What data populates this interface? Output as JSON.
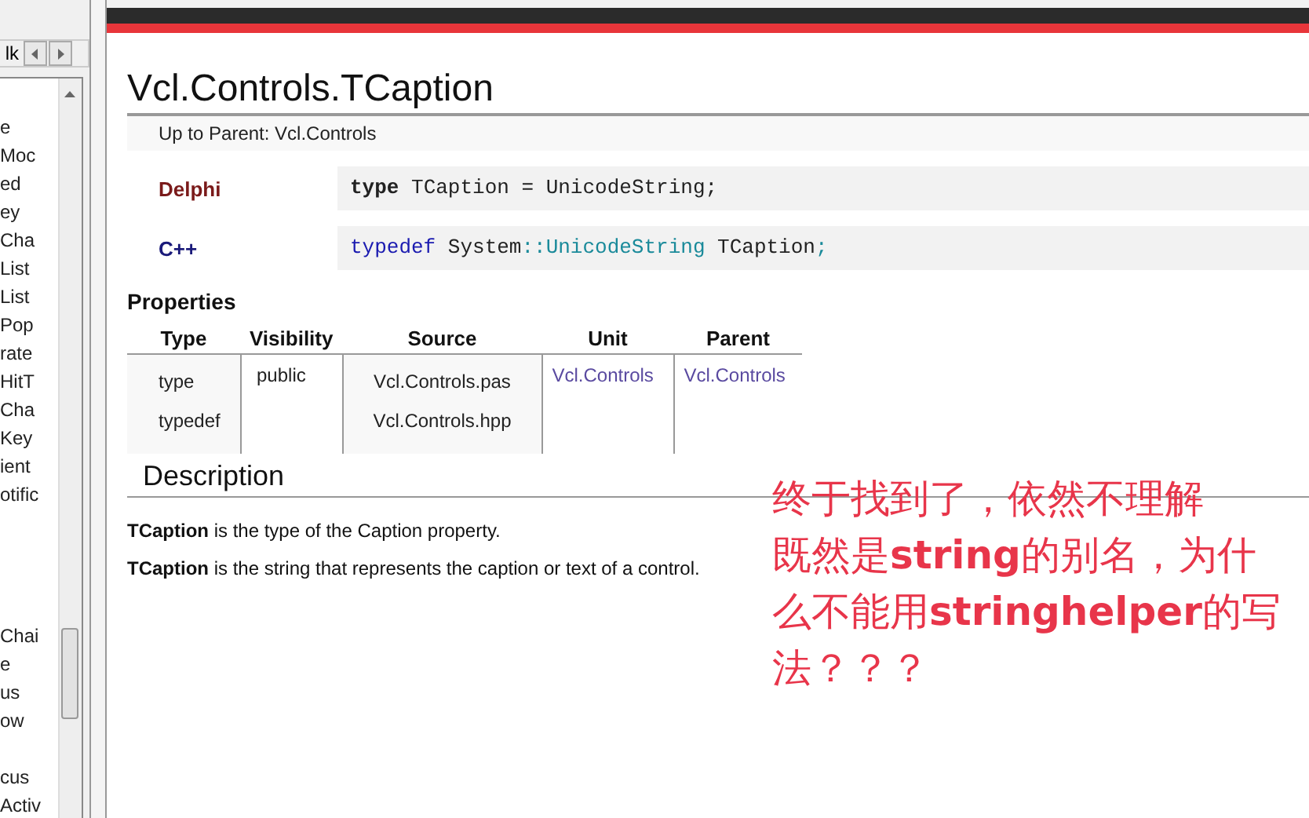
{
  "sidebar": {
    "toolbar_text": "lk",
    "item_groups": [
      [
        "e",
        "Moc",
        "ed",
        "ey",
        "Cha",
        "List",
        "List",
        "Pop",
        "rate",
        "HitT",
        "Cha",
        "Key",
        "ient",
        "otific"
      ],
      [
        "Chai",
        "e",
        "us",
        "ow"
      ],
      [
        "cus",
        "Activ"
      ]
    ]
  },
  "page": {
    "title": "Vcl.Controls.TCaption",
    "parent_link": "Up to Parent: Vcl.Controls",
    "syntax": [
      {
        "language": "Delphi",
        "kind": "delphi",
        "tokens": [
          {
            "text": "type",
            "kind": "keyword"
          },
          {
            "text": " TCaption = UnicodeString;",
            "kind": "plain"
          }
        ]
      },
      {
        "language": "C++",
        "kind": "cpp",
        "tokens": [
          {
            "text": "typedef",
            "kind": "keyword"
          },
          {
            "text": " System",
            "kind": "plain"
          },
          {
            "text": "::",
            "kind": "op"
          },
          {
            "text": "UnicodeString",
            "kind": "type"
          },
          {
            "text": " TCaption",
            "kind": "plain"
          },
          {
            "text": ";",
            "kind": "op"
          }
        ]
      }
    ],
    "properties_heading": "Properties",
    "table": {
      "columns": [
        "Type",
        "Visibility",
        "Source",
        "Unit",
        "Parent"
      ],
      "rows": [
        {
          "type": [
            "type",
            "typedef"
          ],
          "visibility": "public",
          "source": [
            "Vcl.Controls.pas",
            "Vcl.Controls.hpp"
          ],
          "unit": "Vcl.Controls",
          "parent": "Vcl.Controls"
        }
      ]
    },
    "description_heading": "Description",
    "description": [
      "**TCaption** is the type of the Caption property.",
      "**TCaption** is the string that represents the caption or text of a control."
    ]
  },
  "annotation": [
    "终于找到了，依然不理解",
    "既然是**string**的别名，为什",
    "么不能用**stringhelper**的写",
    "法？？？"
  ]
}
